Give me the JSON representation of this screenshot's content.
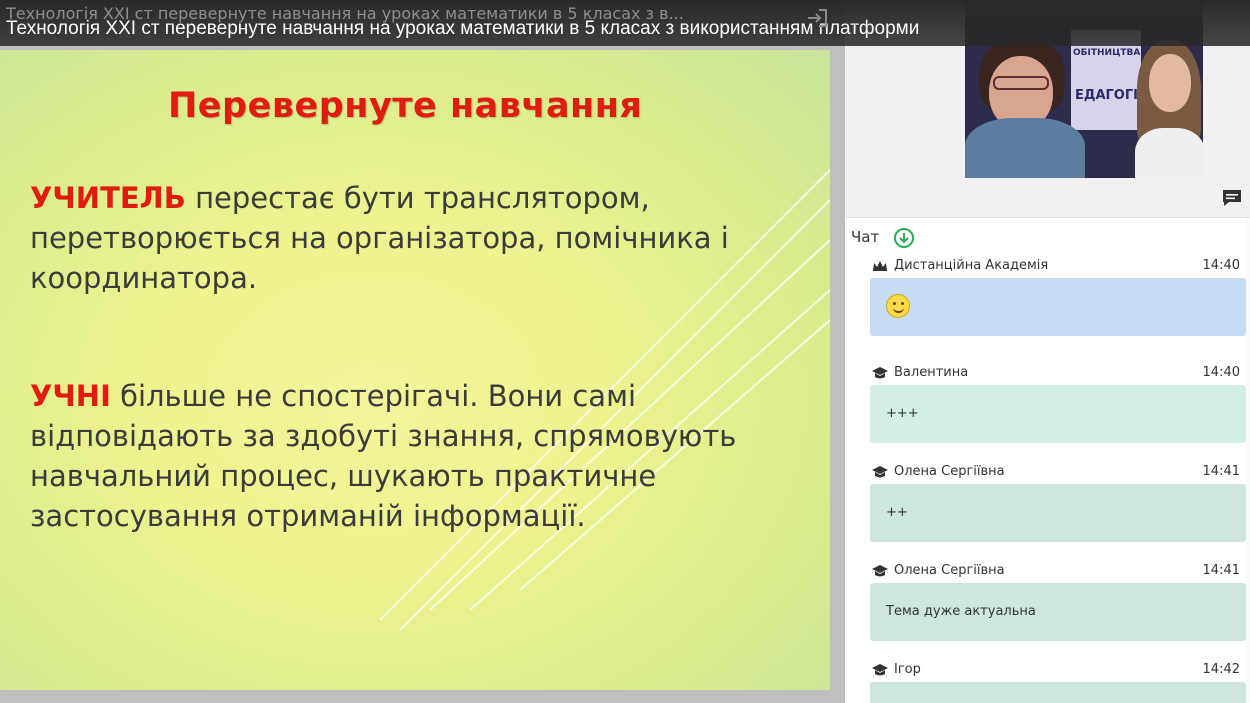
{
  "video": {
    "title": "Технологія XXI ст перевернуте навчання на уроках математики в 5 класах з використанням платформи",
    "title_ghost": "Технологія XXI ст перевернуте навчання на уроках математики в 5 класах з в..."
  },
  "slide": {
    "title": "Перевернуте навчання",
    "paragraphs": [
      {
        "keyword": "УЧИТЕЛЬ",
        "text": " перестає бути транслятором, перетворюється на організатора, помічника і координатора."
      },
      {
        "keyword": "УЧНІ",
        "text": " більше не спостерігачі. Вони самі відповідають за здобуті знання, спрямовують навчальний процес, шукають практичне застосування отриманій інформації."
      }
    ]
  },
  "webcam": {
    "banner_line1": "ОБІТНИЦТВА",
    "banner_line2": "ЕДАГОГІКА"
  },
  "chat": {
    "header": "Чат",
    "messages": [
      {
        "author": "Дистанційна Академія",
        "time": "14:40",
        "text": "",
        "role": "admin",
        "emoji": "smile"
      },
      {
        "author": "Валентина",
        "time": "14:40",
        "text": "+++",
        "role": "student"
      },
      {
        "author": "Олена Сергіївна",
        "time": "14:41",
        "text": "++",
        "role": "student"
      },
      {
        "author": "Олена Сергіївна",
        "time": "14:41",
        "text": "Тема дуже актуальна",
        "role": "student"
      },
      {
        "author": "Ігор",
        "time": "14:42",
        "text": "",
        "role": "student"
      }
    ]
  },
  "colors": {
    "accent_red": "#e01b12",
    "admin_bubble": "#c5dcf4",
    "student_bubble": "#d3efe6"
  }
}
